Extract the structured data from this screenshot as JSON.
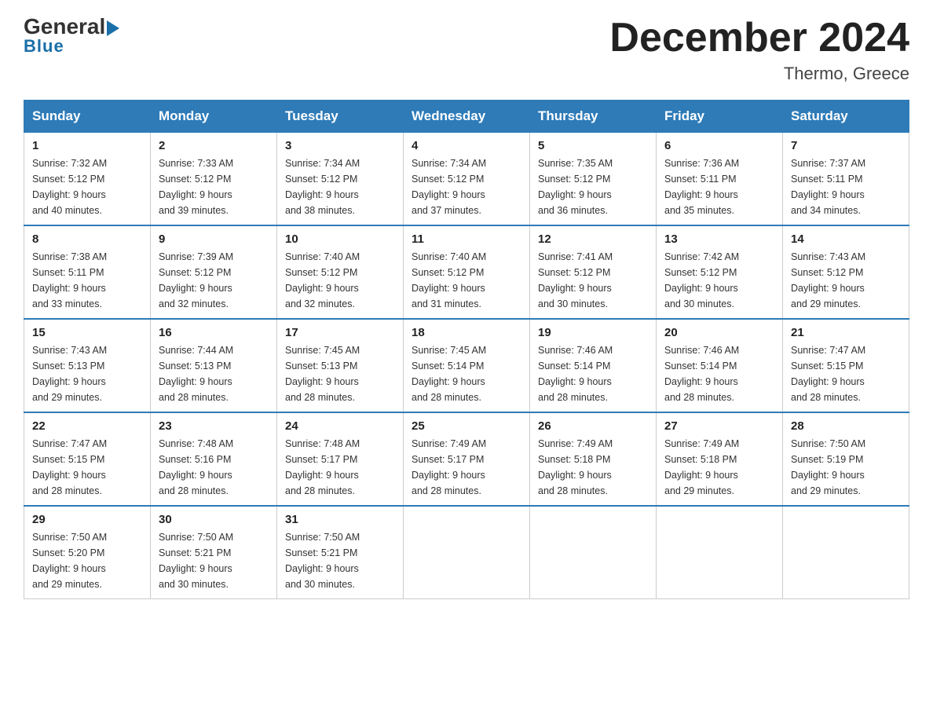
{
  "logo": {
    "general": "General",
    "blue": "Blue",
    "arrow": "▶"
  },
  "header": {
    "month_year": "December 2024",
    "location": "Thermo, Greece"
  },
  "weekdays": [
    "Sunday",
    "Monday",
    "Tuesday",
    "Wednesday",
    "Thursday",
    "Friday",
    "Saturday"
  ],
  "weeks": [
    [
      {
        "day": "1",
        "sunrise": "7:32 AM",
        "sunset": "5:12 PM",
        "daylight": "9 hours and 40 minutes."
      },
      {
        "day": "2",
        "sunrise": "7:33 AM",
        "sunset": "5:12 PM",
        "daylight": "9 hours and 39 minutes."
      },
      {
        "day": "3",
        "sunrise": "7:34 AM",
        "sunset": "5:12 PM",
        "daylight": "9 hours and 38 minutes."
      },
      {
        "day": "4",
        "sunrise": "7:34 AM",
        "sunset": "5:12 PM",
        "daylight": "9 hours and 37 minutes."
      },
      {
        "day": "5",
        "sunrise": "7:35 AM",
        "sunset": "5:12 PM",
        "daylight": "9 hours and 36 minutes."
      },
      {
        "day": "6",
        "sunrise": "7:36 AM",
        "sunset": "5:11 PM",
        "daylight": "9 hours and 35 minutes."
      },
      {
        "day": "7",
        "sunrise": "7:37 AM",
        "sunset": "5:11 PM",
        "daylight": "9 hours and 34 minutes."
      }
    ],
    [
      {
        "day": "8",
        "sunrise": "7:38 AM",
        "sunset": "5:11 PM",
        "daylight": "9 hours and 33 minutes."
      },
      {
        "day": "9",
        "sunrise": "7:39 AM",
        "sunset": "5:12 PM",
        "daylight": "9 hours and 32 minutes."
      },
      {
        "day": "10",
        "sunrise": "7:40 AM",
        "sunset": "5:12 PM",
        "daylight": "9 hours and 32 minutes."
      },
      {
        "day": "11",
        "sunrise": "7:40 AM",
        "sunset": "5:12 PM",
        "daylight": "9 hours and 31 minutes."
      },
      {
        "day": "12",
        "sunrise": "7:41 AM",
        "sunset": "5:12 PM",
        "daylight": "9 hours and 30 minutes."
      },
      {
        "day": "13",
        "sunrise": "7:42 AM",
        "sunset": "5:12 PM",
        "daylight": "9 hours and 30 minutes."
      },
      {
        "day": "14",
        "sunrise": "7:43 AM",
        "sunset": "5:12 PM",
        "daylight": "9 hours and 29 minutes."
      }
    ],
    [
      {
        "day": "15",
        "sunrise": "7:43 AM",
        "sunset": "5:13 PM",
        "daylight": "9 hours and 29 minutes."
      },
      {
        "day": "16",
        "sunrise": "7:44 AM",
        "sunset": "5:13 PM",
        "daylight": "9 hours and 28 minutes."
      },
      {
        "day": "17",
        "sunrise": "7:45 AM",
        "sunset": "5:13 PM",
        "daylight": "9 hours and 28 minutes."
      },
      {
        "day": "18",
        "sunrise": "7:45 AM",
        "sunset": "5:14 PM",
        "daylight": "9 hours and 28 minutes."
      },
      {
        "day": "19",
        "sunrise": "7:46 AM",
        "sunset": "5:14 PM",
        "daylight": "9 hours and 28 minutes."
      },
      {
        "day": "20",
        "sunrise": "7:46 AM",
        "sunset": "5:14 PM",
        "daylight": "9 hours and 28 minutes."
      },
      {
        "day": "21",
        "sunrise": "7:47 AM",
        "sunset": "5:15 PM",
        "daylight": "9 hours and 28 minutes."
      }
    ],
    [
      {
        "day": "22",
        "sunrise": "7:47 AM",
        "sunset": "5:15 PM",
        "daylight": "9 hours and 28 minutes."
      },
      {
        "day": "23",
        "sunrise": "7:48 AM",
        "sunset": "5:16 PM",
        "daylight": "9 hours and 28 minutes."
      },
      {
        "day": "24",
        "sunrise": "7:48 AM",
        "sunset": "5:17 PM",
        "daylight": "9 hours and 28 minutes."
      },
      {
        "day": "25",
        "sunrise": "7:49 AM",
        "sunset": "5:17 PM",
        "daylight": "9 hours and 28 minutes."
      },
      {
        "day": "26",
        "sunrise": "7:49 AM",
        "sunset": "5:18 PM",
        "daylight": "9 hours and 28 minutes."
      },
      {
        "day": "27",
        "sunrise": "7:49 AM",
        "sunset": "5:18 PM",
        "daylight": "9 hours and 29 minutes."
      },
      {
        "day": "28",
        "sunrise": "7:50 AM",
        "sunset": "5:19 PM",
        "daylight": "9 hours and 29 minutes."
      }
    ],
    [
      {
        "day": "29",
        "sunrise": "7:50 AM",
        "sunset": "5:20 PM",
        "daylight": "9 hours and 29 minutes."
      },
      {
        "day": "30",
        "sunrise": "7:50 AM",
        "sunset": "5:21 PM",
        "daylight": "9 hours and 30 minutes."
      },
      {
        "day": "31",
        "sunrise": "7:50 AM",
        "sunset": "5:21 PM",
        "daylight": "9 hours and 30 minutes."
      },
      null,
      null,
      null,
      null
    ]
  ],
  "labels": {
    "sunrise": "Sunrise:",
    "sunset": "Sunset:",
    "daylight": "Daylight:"
  }
}
